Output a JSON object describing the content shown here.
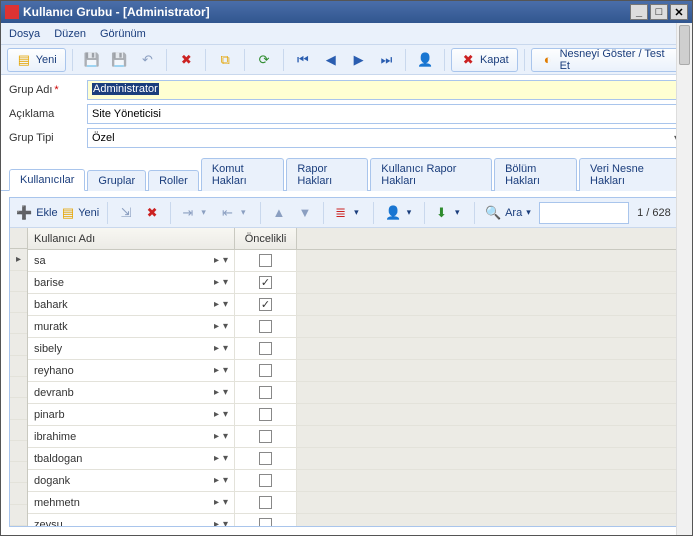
{
  "window": {
    "title": "Kullanıcı Grubu - [Administrator]"
  },
  "menu": {
    "file": "Dosya",
    "edit": "Düzen",
    "view": "Görünüm"
  },
  "maintoolbar": {
    "new": "Yeni",
    "close": "Kapat",
    "show_test": "Nesneyi Göster / Test Et"
  },
  "form": {
    "group_name_label": "Grup Adı",
    "group_name_value": "Administrator",
    "desc_label": "Açıklama",
    "desc_value": "Site Yöneticisi",
    "type_label": "Grup Tipi",
    "type_value": "Özel"
  },
  "tabs": [
    {
      "label": "Kullanıcılar",
      "active": true
    },
    {
      "label": "Gruplar",
      "active": false
    },
    {
      "label": "Roller",
      "active": false
    },
    {
      "label": "Komut Hakları",
      "active": false
    },
    {
      "label": "Rapor Hakları",
      "active": false
    },
    {
      "label": "Kullanıcı Rapor Hakları",
      "active": false
    },
    {
      "label": "Bölüm Hakları",
      "active": false
    },
    {
      "label": "Veri Nesne Hakları",
      "active": false
    }
  ],
  "innertoolbar": {
    "add": "Ekle",
    "new": "Yeni",
    "search": "Ara",
    "page_info": "1 / 628"
  },
  "grid": {
    "headers": {
      "user": "Kullanıcı Adı",
      "priority": "Öncelikli"
    },
    "rows": [
      {
        "user": "sa",
        "priority": false,
        "current": true
      },
      {
        "user": "barise",
        "priority": true,
        "current": false
      },
      {
        "user": "bahark",
        "priority": true,
        "current": false
      },
      {
        "user": "muratk",
        "priority": false,
        "current": false
      },
      {
        "user": "sibely",
        "priority": false,
        "current": false
      },
      {
        "user": "reyhano",
        "priority": false,
        "current": false
      },
      {
        "user": "devranb",
        "priority": false,
        "current": false
      },
      {
        "user": "pinarb",
        "priority": false,
        "current": false
      },
      {
        "user": "ibrahime",
        "priority": false,
        "current": false
      },
      {
        "user": "tbaldogan",
        "priority": false,
        "current": false
      },
      {
        "user": "dogank",
        "priority": false,
        "current": false
      },
      {
        "user": "mehmetn",
        "priority": false,
        "current": false
      },
      {
        "user": "zeysu",
        "priority": false,
        "current": false
      }
    ]
  }
}
